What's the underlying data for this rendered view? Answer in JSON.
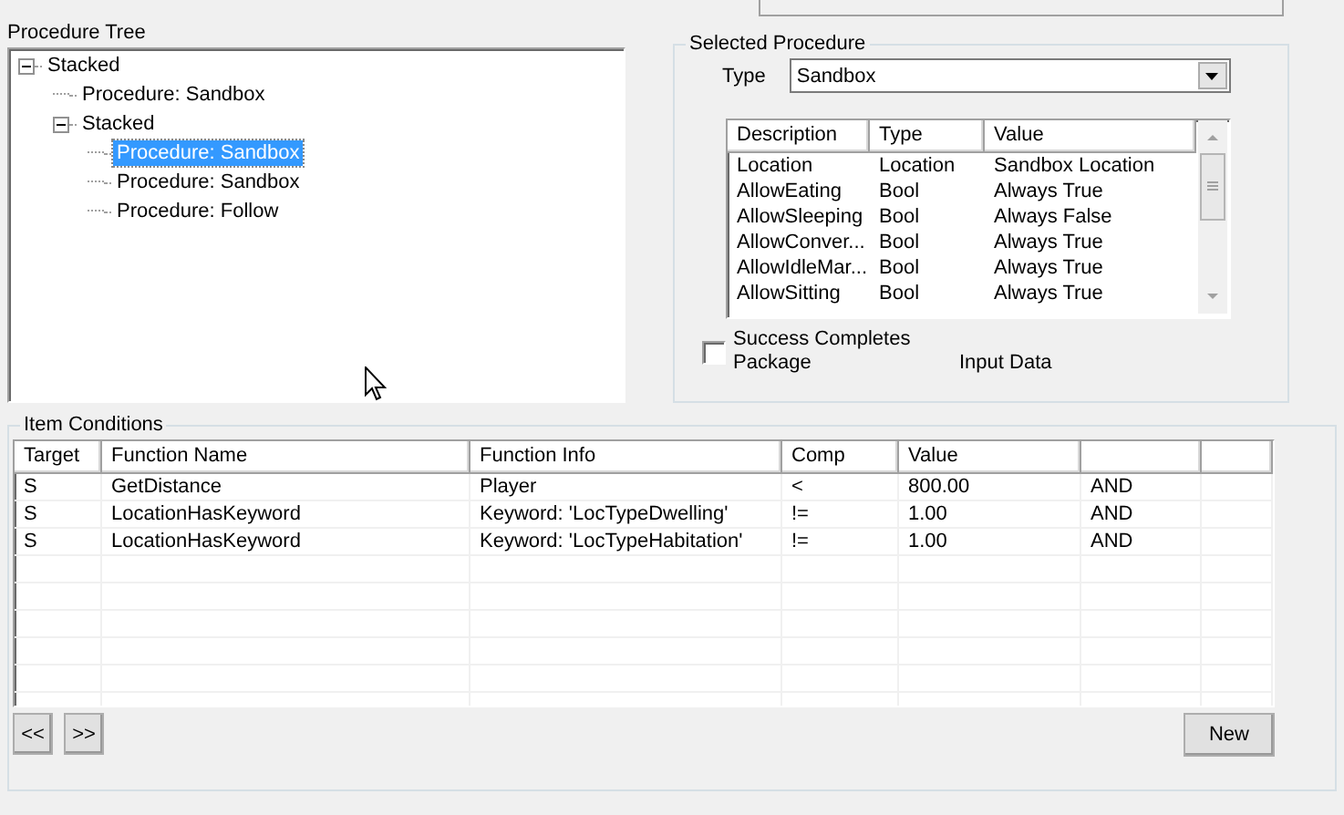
{
  "procedure_tree": {
    "title": "Procedure Tree",
    "nodes": [
      {
        "label": "Stacked",
        "expanded": true,
        "selected": false,
        "children": [
          {
            "label": "Procedure: Sandbox",
            "selected": false
          },
          {
            "label": "Stacked",
            "expanded": true,
            "selected": false,
            "children": [
              {
                "label": "Procedure: Sandbox",
                "selected": true
              },
              {
                "label": "Procedure: Sandbox",
                "selected": false
              },
              {
                "label": "Procedure: Follow",
                "selected": false
              }
            ]
          }
        ]
      }
    ]
  },
  "selected_procedure": {
    "title": "Selected Procedure",
    "type_label": "Type",
    "type_value": "Sandbox",
    "properties": {
      "columns": [
        "Description",
        "Type",
        "Value"
      ],
      "rows": [
        [
          "Location",
          "Location",
          "Sandbox Location"
        ],
        [
          "AllowEating",
          "Bool",
          "Always True"
        ],
        [
          "AllowSleeping",
          "Bool",
          "Always False"
        ],
        [
          "AllowConver...",
          "Bool",
          "Always True"
        ],
        [
          "AllowIdleMar...",
          "Bool",
          "Always True"
        ],
        [
          "AllowSitting",
          "Bool",
          "Always True"
        ]
      ]
    },
    "success_completes_package": {
      "label": "Success Completes Package",
      "checked": false
    },
    "input_data_label": "Input Data"
  },
  "item_conditions": {
    "title": "Item Conditions",
    "columns": [
      "Target",
      "Function Name",
      "Function Info",
      "Comp",
      "Value"
    ],
    "rows": [
      {
        "target": "S",
        "function_name": "GetDistance",
        "function_info": "Player",
        "comp": "<",
        "value": "800.00",
        "column_6": "AND"
      },
      {
        "target": "S",
        "function_name": "LocationHasKeyword",
        "function_info": "Keyword: 'LocTypeDwelling'",
        "comp": "!=",
        "value": "1.00",
        "column_6": "AND"
      },
      {
        "target": "S",
        "function_name": "LocationHasKeyword",
        "function_info": "Keyword: 'LocTypeHabitation'",
        "comp": "!=",
        "value": "1.00",
        "column_6": "AND"
      }
    ],
    "buttons": {
      "previous": "<<",
      "next": ">>",
      "new": "New"
    }
  }
}
